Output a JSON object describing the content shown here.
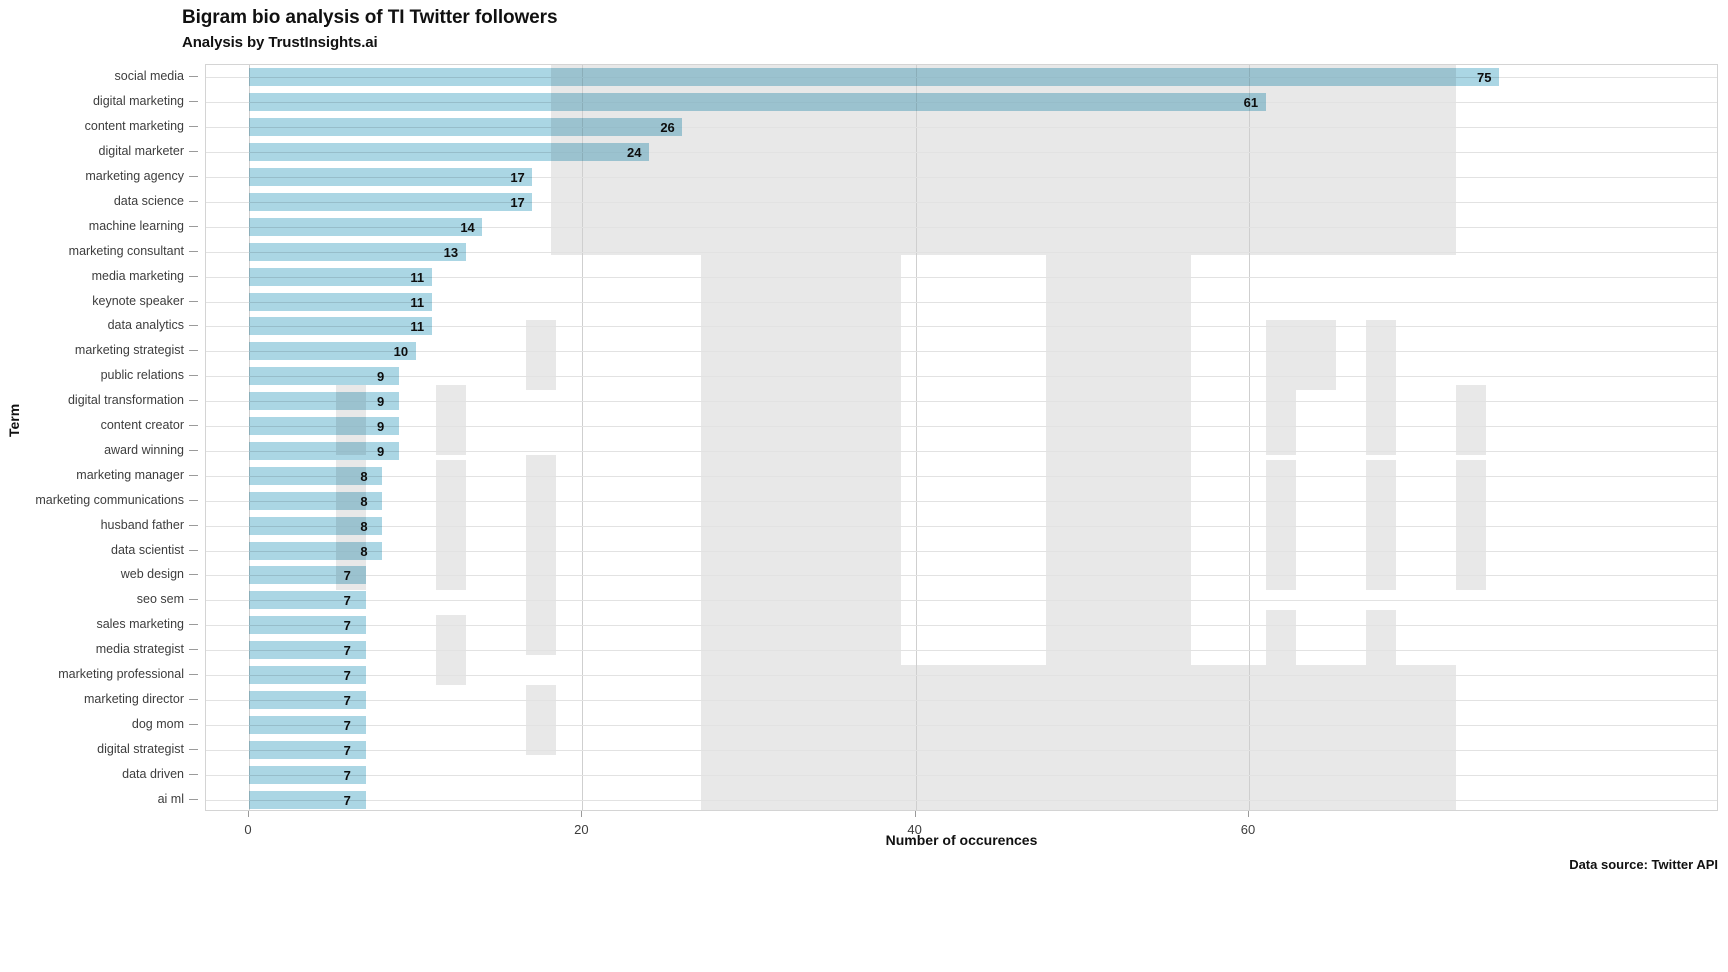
{
  "header": {
    "title": "Bigram bio analysis of TI Twitter followers",
    "subtitle": "Analysis by TrustInsights.ai"
  },
  "footer": {
    "data_source": "Data source: Twitter API"
  },
  "watermark": {
    "text": "TI",
    "color": "#e8e8e8"
  },
  "chart_data": {
    "type": "bar",
    "orientation": "horizontal",
    "title": "Bigram bio analysis of TI Twitter followers",
    "subtitle": "Analysis by TrustInsights.ai",
    "xlabel": "Number of occurences",
    "ylabel": "Term",
    "xlim": [
      -3,
      88
    ],
    "xticks": [
      0,
      20,
      40,
      60
    ],
    "xtick_labels": [
      "0",
      "20",
      "40",
      "60"
    ],
    "grid": "vertical-and-horizontal",
    "legend": "none",
    "bar_color": "#abd6e4",
    "label_color": "#0d0d0d",
    "categories": [
      "social media",
      "digital marketing",
      "content marketing",
      "digital marketer",
      "marketing agency",
      "data science",
      "machine learning",
      "marketing consultant",
      "media marketing",
      "keynote speaker",
      "data analytics",
      "marketing strategist",
      "public relations",
      "digital transformation",
      "content creator",
      "award winning",
      "marketing manager",
      "marketing communications",
      "husband father",
      "data scientist",
      "web design",
      "seo sem",
      "sales marketing",
      "media strategist",
      "marketing professional",
      "marketing director",
      "dog mom",
      "digital strategist",
      "data driven",
      "ai ml"
    ],
    "values": [
      75,
      61,
      26,
      24,
      17,
      17,
      14,
      13,
      11,
      11,
      11,
      10,
      9,
      9,
      9,
      9,
      8,
      8,
      8,
      8,
      7,
      7,
      7,
      7,
      7,
      7,
      7,
      7,
      7,
      7
    ],
    "value_labels": [
      "75",
      "61",
      "26",
      "24",
      "17",
      "17",
      "14",
      "13",
      "11",
      "11",
      "11",
      "10",
      "9",
      "9",
      "9",
      "9",
      "8",
      "8",
      "8",
      "8",
      "7",
      "7",
      "7",
      "7",
      "7",
      "7",
      "7",
      "7",
      "7",
      "7"
    ]
  }
}
